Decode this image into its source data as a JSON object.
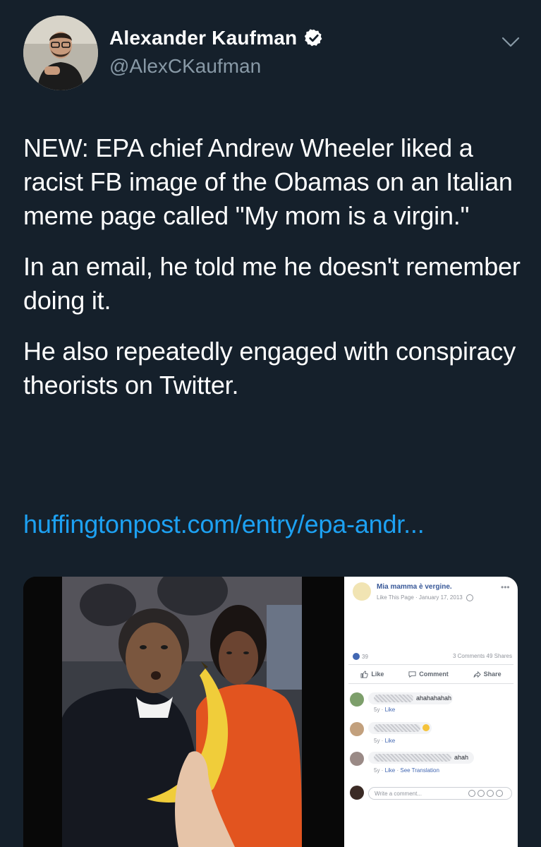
{
  "author": {
    "name": "Alexander Kaufman",
    "handle": "@AlexCKaufman"
  },
  "tweet": {
    "paragraphs": [
      "NEW: EPA chief Andrew Wheeler liked a racist FB image of the Obamas on an Italian meme page called \"My mom is a virgin.\"",
      "In an email, he told me he doesn't remember doing it.",
      "He also repeatedly engaged with conspiracy theorists on Twitter."
    ],
    "link": "huffingtonpost.com/entry/epa-andr..."
  },
  "facebook_post": {
    "page_name": "Mia mamma è vergine.",
    "like_page": "Like This Page",
    "date": "January 17, 2013",
    "reactions_count": "39",
    "comments_count": "3 Comments",
    "shares_count": "49 Shares",
    "actions": {
      "like": "Like",
      "comment": "Comment",
      "share": "Share"
    },
    "comments": [
      {
        "text": "ahahahahah",
        "time": "5y",
        "like": "Like",
        "extra": ""
      },
      {
        "text": "",
        "time": "5y",
        "like": "Like",
        "extra": ""
      },
      {
        "text": "ahah",
        "time": "5y",
        "like": "Like",
        "extra": "See Translation"
      }
    ],
    "write_placeholder": "Write a comment..."
  },
  "colors": {
    "background": "#15202b",
    "link": "#1da1f2",
    "verified": "#ffffff",
    "handle": "#8899a6"
  },
  "icons": [
    "verified-badge-icon",
    "chevron-down-icon",
    "like-thumb-icon",
    "comment-icon",
    "share-arrow-icon",
    "globe-icon",
    "emoji-icon",
    "camera-icon",
    "gif-icon",
    "sticker-icon"
  ]
}
